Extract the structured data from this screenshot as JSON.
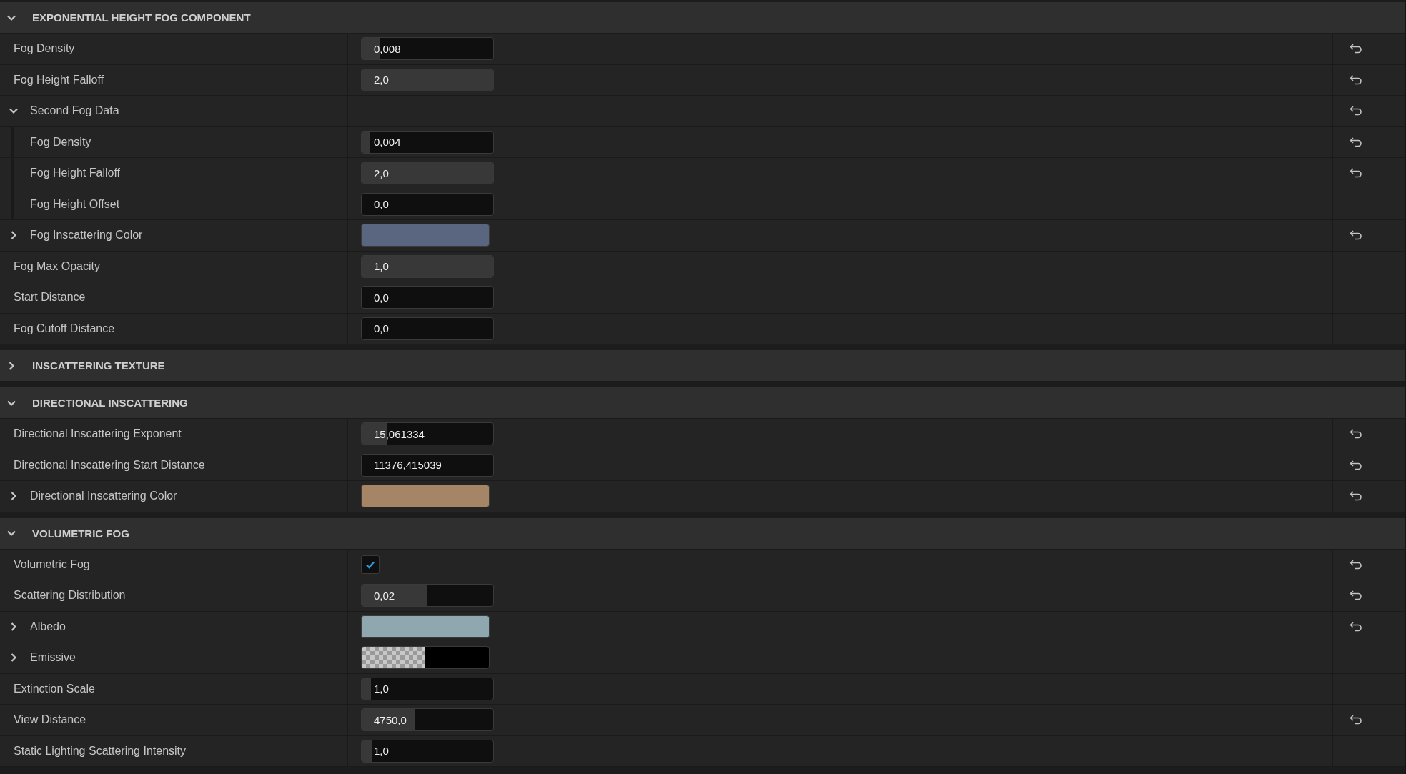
{
  "sections": [
    {
      "title": "EXPONENTIAL HEIGHT FOG COMPONENT",
      "expanded": true,
      "rows": [
        {
          "kind": "number",
          "label": "Fog Density",
          "value": "0,008",
          "level": 0.14,
          "resettable": true
        },
        {
          "kind": "number",
          "label": "Fog Height Falloff",
          "value": "2,0",
          "level": 1,
          "resettable": true
        },
        {
          "kind": "group",
          "label": "Second Fog Data",
          "expanded": true,
          "resettable": true,
          "children": [
            {
              "kind": "number",
              "label": "Fog Density",
              "value": "0,004",
              "level": 0.06,
              "resettable": true
            },
            {
              "kind": "number",
              "label": "Fog Height Falloff",
              "value": "2,0",
              "level": 1,
              "resettable": true
            },
            {
              "kind": "number",
              "label": "Fog Height Offset",
              "value": "0,0",
              "level": 0,
              "resettable": false
            }
          ]
        },
        {
          "kind": "color",
          "label": "Fog Inscattering Color",
          "expanded": false,
          "color": "#5a6680",
          "transparent": false,
          "resettable": true
        },
        {
          "kind": "number",
          "label": "Fog Max Opacity",
          "value": "1,0",
          "level": 1,
          "resettable": false
        },
        {
          "kind": "number",
          "label": "Start Distance",
          "value": "0,0",
          "level": 0,
          "resettable": false
        },
        {
          "kind": "number",
          "label": "Fog Cutoff Distance",
          "value": "0,0",
          "level": 0,
          "resettable": false
        }
      ]
    },
    {
      "title": "INSCATTERING TEXTURE",
      "expanded": false
    },
    {
      "title": "DIRECTIONAL INSCATTERING",
      "expanded": true,
      "rows": [
        {
          "kind": "number",
          "label": "Directional Inscattering Exponent",
          "value": "15,061334",
          "level": 0.19,
          "resettable": true
        },
        {
          "kind": "number",
          "label": "Directional Inscattering Start Distance",
          "value": "11376,415039",
          "level": 0,
          "resettable": true
        },
        {
          "kind": "color",
          "label": "Directional Inscattering Color",
          "expanded": false,
          "color": "#a58566",
          "transparent": false,
          "resettable": true
        }
      ]
    },
    {
      "title": "VOLUMETRIC FOG",
      "expanded": true,
      "rows": [
        {
          "kind": "checkbox",
          "label": "Volumetric Fog",
          "checked": true,
          "resettable": true
        },
        {
          "kind": "number",
          "label": "Scattering Distribution",
          "value": "0,02",
          "level": 0.5,
          "resettable": true
        },
        {
          "kind": "color",
          "label": "Albedo",
          "expanded": false,
          "color": "#8fa8b0",
          "transparent": false,
          "resettable": true
        },
        {
          "kind": "color",
          "label": "Emissive",
          "expanded": false,
          "color": "#000000",
          "transparent": true,
          "resettable": false
        },
        {
          "kind": "number",
          "label": "Extinction Scale",
          "value": "1,0",
          "level": 0.07,
          "resettable": false
        },
        {
          "kind": "number",
          "label": "View Distance",
          "value": "4750,0",
          "level": 0.4,
          "resettable": true
        },
        {
          "kind": "number",
          "label": "Static Lighting Scattering Intensity",
          "value": "1,0",
          "level": 0.08,
          "resettable": false
        }
      ]
    }
  ]
}
